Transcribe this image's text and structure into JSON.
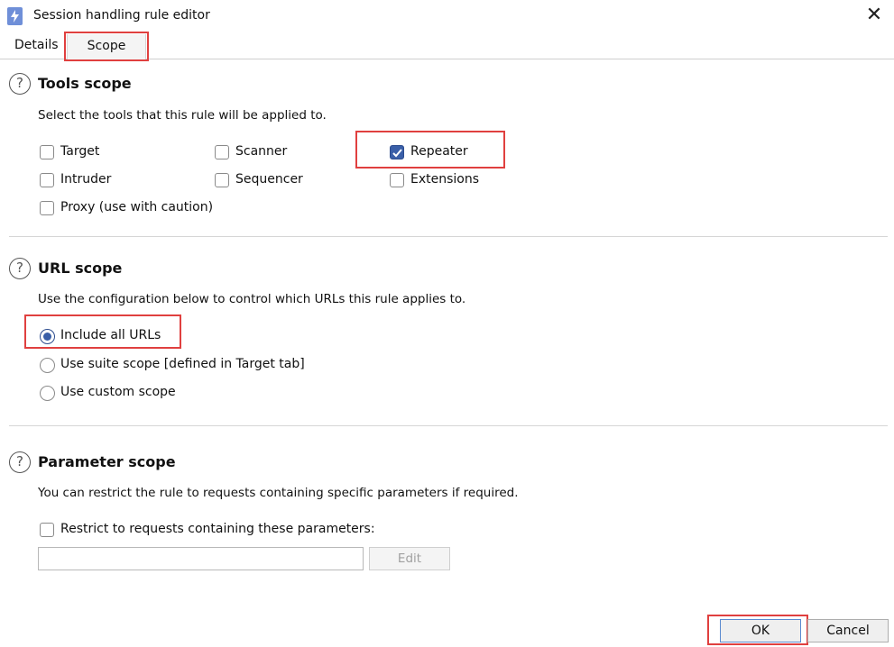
{
  "window": {
    "title": "Session handling rule editor",
    "icon": "burp-lightning-icon"
  },
  "tabs": [
    {
      "label": "Details"
    },
    {
      "label": "Scope"
    }
  ],
  "tools_scope": {
    "title": "Tools scope",
    "description": "Select the tools that this rule will be applied to.",
    "options": [
      {
        "label": "Target",
        "checked": false
      },
      {
        "label": "Scanner",
        "checked": false
      },
      {
        "label": "Repeater",
        "checked": true
      },
      {
        "label": "Intruder",
        "checked": false
      },
      {
        "label": "Sequencer",
        "checked": false
      },
      {
        "label": "Extensions",
        "checked": false
      },
      {
        "label": "Proxy (use with caution)",
        "checked": false
      }
    ]
  },
  "url_scope": {
    "title": "URL scope",
    "description": "Use the configuration below to control which URLs this rule applies to.",
    "options": [
      {
        "label": "Include all URLs",
        "selected": true
      },
      {
        "label": "Use suite scope [defined in Target tab]",
        "selected": false
      },
      {
        "label": "Use custom scope",
        "selected": false
      }
    ]
  },
  "parameter_scope": {
    "title": "Parameter scope",
    "description": "You can restrict the rule to requests containing specific parameters if required.",
    "restrict_label": "Restrict to requests containing these parameters:",
    "restrict_checked": false,
    "input_value": "",
    "edit_label": "Edit"
  },
  "footer": {
    "ok_label": "OK",
    "cancel_label": "Cancel"
  },
  "colors": {
    "highlight": "#e0403f",
    "accent": "#3a5fa8"
  }
}
